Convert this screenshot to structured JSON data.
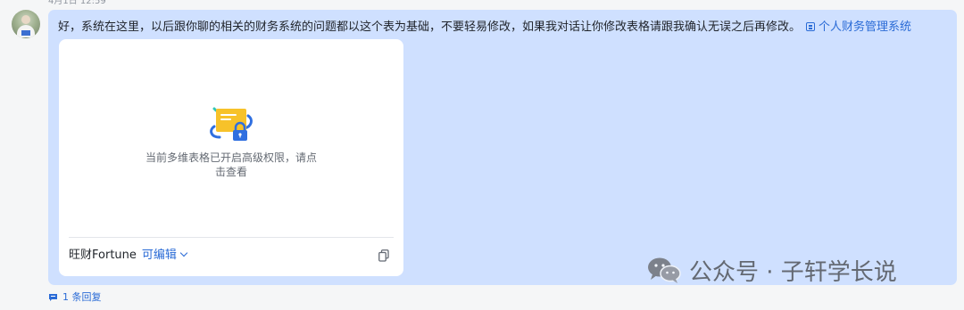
{
  "message": {
    "timestamp": "4月1日 12:59",
    "text": "好，系统在这里，以后跟你聊的相关的财务系统的问题都以这个表为基础，不要轻易修改，如果我对话让你修改表格请跟我确认无误之后再修改。",
    "link_label": "个人财务管理系统"
  },
  "card": {
    "notice": "当前多维表格已开启高级权限，请点击查看",
    "owner": "旺财Fortune",
    "permission": "可编辑"
  },
  "replies": {
    "label": "1 条回复"
  },
  "watermark": {
    "text": "公众号 · 子轩学长说"
  },
  "colors": {
    "bubble": "#cfe0ff",
    "link": "#2a6bd6",
    "background": "#f5f6f7"
  }
}
